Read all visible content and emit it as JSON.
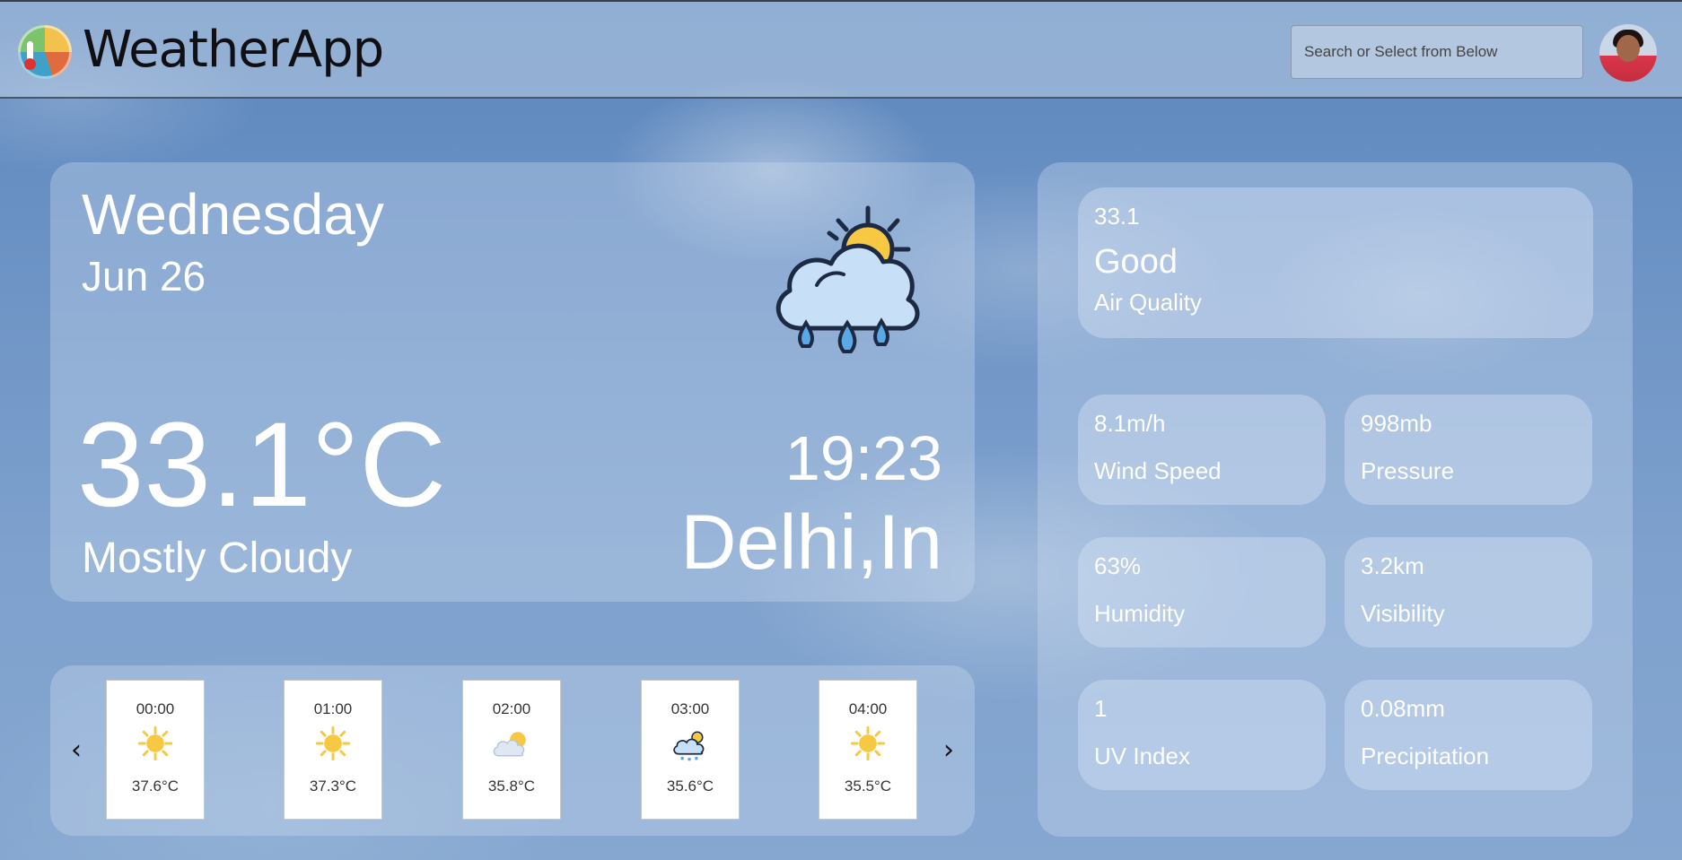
{
  "header": {
    "app_name": "WeatherApp",
    "search_placeholder": "Search or Select from Below"
  },
  "current": {
    "day": "Wednesday",
    "date": "Jun 26",
    "temperature": "33.1°C",
    "condition": "Mostly Cloudy",
    "time": "19:23",
    "location": "Delhi,In",
    "icon": "cloud-sun-rain-icon"
  },
  "hourly": [
    {
      "time": "00:00",
      "icon": "sun-icon",
      "temp": "37.6°C"
    },
    {
      "time": "01:00",
      "icon": "sun-icon",
      "temp": "37.3°C"
    },
    {
      "time": "02:00",
      "icon": "partly-cloudy-icon",
      "temp": "35.8°C"
    },
    {
      "time": "03:00",
      "icon": "cloud-sun-rain-icon",
      "temp": "35.6°C"
    },
    {
      "time": "04:00",
      "icon": "sun-icon",
      "temp": "35.5°C"
    }
  ],
  "nav": {
    "prev": "‹",
    "next": "›"
  },
  "air_quality": {
    "value": "33.1",
    "rating": "Good",
    "label": "Air Quality"
  },
  "stats": {
    "wind": {
      "value": "8.1m/h",
      "label": "Wind Speed"
    },
    "pressure": {
      "value": "998mb",
      "label": "Pressure"
    },
    "humidity": {
      "value": "63%",
      "label": "Humidity"
    },
    "visibility": {
      "value": "3.2km",
      "label": "Visibility"
    },
    "uv": {
      "value": "1",
      "label": "UV Index"
    },
    "precip": {
      "value": "0.08mm",
      "label": "Precipitation"
    }
  },
  "colors": {
    "sun": "#f7c844",
    "cloud": "#c7e0f7",
    "outline": "#1d2a44"
  }
}
